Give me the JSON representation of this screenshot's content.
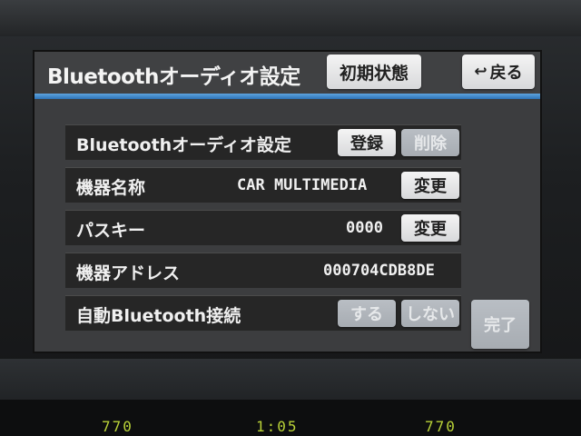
{
  "header": {
    "title": "Bluetoothオーディオ設定",
    "initial_state_label": "初期状態",
    "back_label": "戻る",
    "back_arrow": "↩"
  },
  "rows": [
    {
      "label": "Bluetoothオーディオ設定",
      "buttons": [
        "登録",
        "削除"
      ]
    },
    {
      "label": "機器名称",
      "value": "CAR MULTIMEDIA",
      "button": "変更"
    },
    {
      "label": "パスキー",
      "value": "0000",
      "button": "変更"
    },
    {
      "label": "機器アドレス",
      "value": "000704CDB8DE"
    },
    {
      "label": "自動Bluetooth接続",
      "buttons": [
        "する",
        "しない"
      ]
    }
  ],
  "done_label": "完了",
  "lower_display": [
    "770",
    "1:05",
    "770"
  ],
  "colors": {
    "accent_line": "#3a86cc",
    "screen_bg": "#3c3d3f",
    "row_bg": "#262626",
    "button_active": "#e8e8ea",
    "button_disabled": "#aeb3b9"
  }
}
